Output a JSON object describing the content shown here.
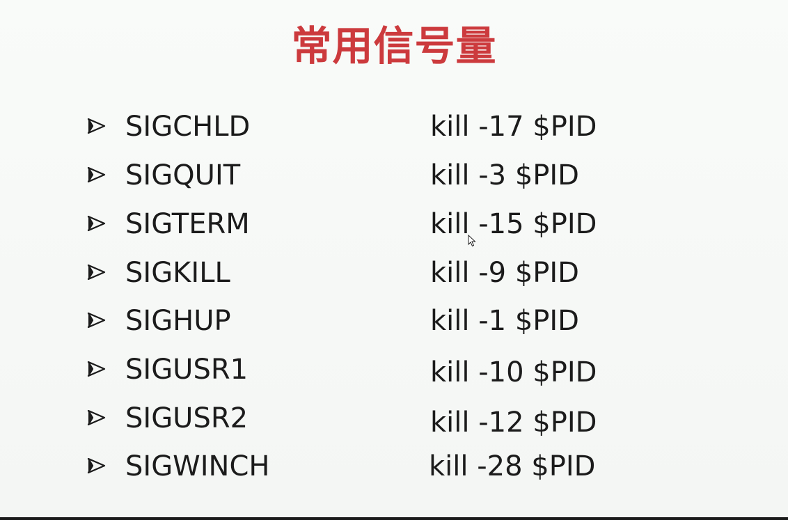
{
  "slide": {
    "title": "常用信号量",
    "title_color": "#cc3a3d",
    "bullet_icon": "arrow-bullet-icon",
    "signals": [
      {
        "name": "SIGCHLD",
        "command": "kill -17 $PID"
      },
      {
        "name": "SIGQUIT",
        "command": "kill -3 $PID"
      },
      {
        "name": "SIGTERM",
        "command": "kill -15 $PID"
      },
      {
        "name": "SIGKILL",
        "command": "kill -9 $PID"
      },
      {
        "name": "SIGHUP",
        "command": "kill -1 $PID"
      },
      {
        "name": "SIGUSR1",
        "command": "kill -10 $PID"
      },
      {
        "name": "SIGUSR2",
        "command": "kill -12 $PID"
      },
      {
        "name": "SIGWINCH",
        "command": "kill -28 $PID"
      }
    ]
  }
}
